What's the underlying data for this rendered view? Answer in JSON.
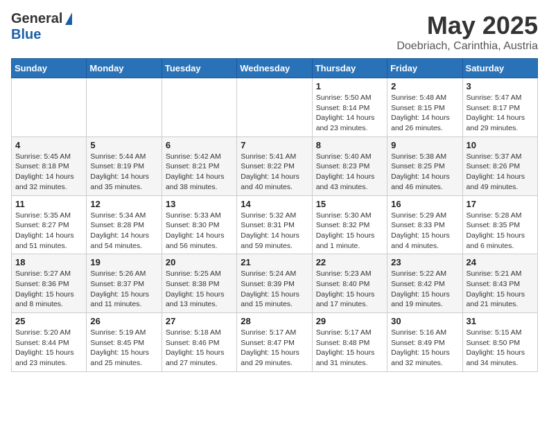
{
  "logo": {
    "general": "General",
    "blue": "Blue"
  },
  "title": "May 2025",
  "subtitle": "Doebriach, Carinthia, Austria",
  "days_of_week": [
    "Sunday",
    "Monday",
    "Tuesday",
    "Wednesday",
    "Thursday",
    "Friday",
    "Saturday"
  ],
  "weeks": [
    [
      {
        "day": "",
        "info": ""
      },
      {
        "day": "",
        "info": ""
      },
      {
        "day": "",
        "info": ""
      },
      {
        "day": "",
        "info": ""
      },
      {
        "day": "1",
        "info": "Sunrise: 5:50 AM\nSunset: 8:14 PM\nDaylight: 14 hours\nand 23 minutes."
      },
      {
        "day": "2",
        "info": "Sunrise: 5:48 AM\nSunset: 8:15 PM\nDaylight: 14 hours\nand 26 minutes."
      },
      {
        "day": "3",
        "info": "Sunrise: 5:47 AM\nSunset: 8:17 PM\nDaylight: 14 hours\nand 29 minutes."
      }
    ],
    [
      {
        "day": "4",
        "info": "Sunrise: 5:45 AM\nSunset: 8:18 PM\nDaylight: 14 hours\nand 32 minutes."
      },
      {
        "day": "5",
        "info": "Sunrise: 5:44 AM\nSunset: 8:19 PM\nDaylight: 14 hours\nand 35 minutes."
      },
      {
        "day": "6",
        "info": "Sunrise: 5:42 AM\nSunset: 8:21 PM\nDaylight: 14 hours\nand 38 minutes."
      },
      {
        "day": "7",
        "info": "Sunrise: 5:41 AM\nSunset: 8:22 PM\nDaylight: 14 hours\nand 40 minutes."
      },
      {
        "day": "8",
        "info": "Sunrise: 5:40 AM\nSunset: 8:23 PM\nDaylight: 14 hours\nand 43 minutes."
      },
      {
        "day": "9",
        "info": "Sunrise: 5:38 AM\nSunset: 8:25 PM\nDaylight: 14 hours\nand 46 minutes."
      },
      {
        "day": "10",
        "info": "Sunrise: 5:37 AM\nSunset: 8:26 PM\nDaylight: 14 hours\nand 49 minutes."
      }
    ],
    [
      {
        "day": "11",
        "info": "Sunrise: 5:35 AM\nSunset: 8:27 PM\nDaylight: 14 hours\nand 51 minutes."
      },
      {
        "day": "12",
        "info": "Sunrise: 5:34 AM\nSunset: 8:28 PM\nDaylight: 14 hours\nand 54 minutes."
      },
      {
        "day": "13",
        "info": "Sunrise: 5:33 AM\nSunset: 8:30 PM\nDaylight: 14 hours\nand 56 minutes."
      },
      {
        "day": "14",
        "info": "Sunrise: 5:32 AM\nSunset: 8:31 PM\nDaylight: 14 hours\nand 59 minutes."
      },
      {
        "day": "15",
        "info": "Sunrise: 5:30 AM\nSunset: 8:32 PM\nDaylight: 15 hours\nand 1 minute."
      },
      {
        "day": "16",
        "info": "Sunrise: 5:29 AM\nSunset: 8:33 PM\nDaylight: 15 hours\nand 4 minutes."
      },
      {
        "day": "17",
        "info": "Sunrise: 5:28 AM\nSunset: 8:35 PM\nDaylight: 15 hours\nand 6 minutes."
      }
    ],
    [
      {
        "day": "18",
        "info": "Sunrise: 5:27 AM\nSunset: 8:36 PM\nDaylight: 15 hours\nand 8 minutes."
      },
      {
        "day": "19",
        "info": "Sunrise: 5:26 AM\nSunset: 8:37 PM\nDaylight: 15 hours\nand 11 minutes."
      },
      {
        "day": "20",
        "info": "Sunrise: 5:25 AM\nSunset: 8:38 PM\nDaylight: 15 hours\nand 13 minutes."
      },
      {
        "day": "21",
        "info": "Sunrise: 5:24 AM\nSunset: 8:39 PM\nDaylight: 15 hours\nand 15 minutes."
      },
      {
        "day": "22",
        "info": "Sunrise: 5:23 AM\nSunset: 8:40 PM\nDaylight: 15 hours\nand 17 minutes."
      },
      {
        "day": "23",
        "info": "Sunrise: 5:22 AM\nSunset: 8:42 PM\nDaylight: 15 hours\nand 19 minutes."
      },
      {
        "day": "24",
        "info": "Sunrise: 5:21 AM\nSunset: 8:43 PM\nDaylight: 15 hours\nand 21 minutes."
      }
    ],
    [
      {
        "day": "25",
        "info": "Sunrise: 5:20 AM\nSunset: 8:44 PM\nDaylight: 15 hours\nand 23 minutes."
      },
      {
        "day": "26",
        "info": "Sunrise: 5:19 AM\nSunset: 8:45 PM\nDaylight: 15 hours\nand 25 minutes."
      },
      {
        "day": "27",
        "info": "Sunrise: 5:18 AM\nSunset: 8:46 PM\nDaylight: 15 hours\nand 27 minutes."
      },
      {
        "day": "28",
        "info": "Sunrise: 5:17 AM\nSunset: 8:47 PM\nDaylight: 15 hours\nand 29 minutes."
      },
      {
        "day": "29",
        "info": "Sunrise: 5:17 AM\nSunset: 8:48 PM\nDaylight: 15 hours\nand 31 minutes."
      },
      {
        "day": "30",
        "info": "Sunrise: 5:16 AM\nSunset: 8:49 PM\nDaylight: 15 hours\nand 32 minutes."
      },
      {
        "day": "31",
        "info": "Sunrise: 5:15 AM\nSunset: 8:50 PM\nDaylight: 15 hours\nand 34 minutes."
      }
    ]
  ]
}
